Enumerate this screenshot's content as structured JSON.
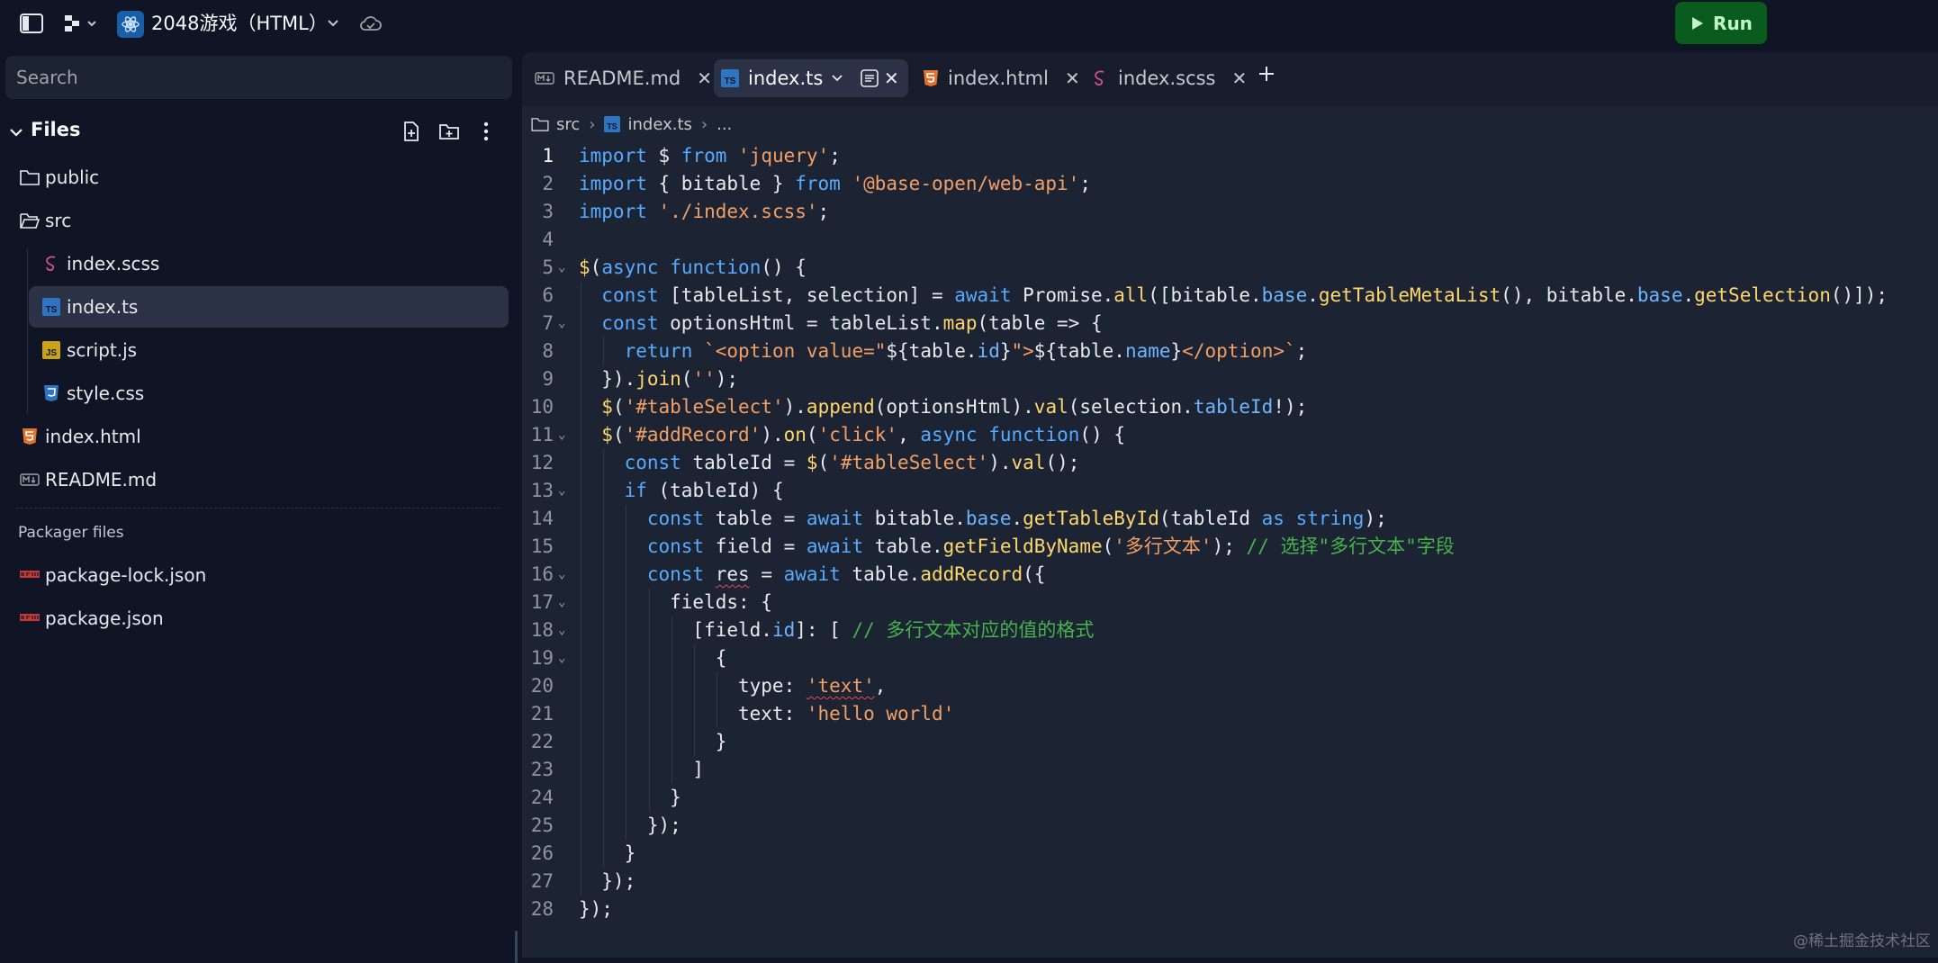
{
  "topbar": {
    "repl_name": "2048游戏（HTML）",
    "run_label": "Run"
  },
  "sidebar": {
    "search_placeholder": "Search",
    "files_title": "Files",
    "tree": [
      {
        "label": "public",
        "icon": "folder-icon"
      },
      {
        "label": "src",
        "icon": "folder-open-icon"
      },
      {
        "label": "index.scss",
        "icon": "scss-file-icon"
      },
      {
        "label": "index.ts",
        "icon": "ts-file-icon",
        "selected": true
      },
      {
        "label": "script.js",
        "icon": "js-file-icon"
      },
      {
        "label": "style.css",
        "icon": "css-file-icon"
      },
      {
        "label": "index.html",
        "icon": "html-file-icon"
      },
      {
        "label": "README.md",
        "icon": "markdown-file-icon"
      }
    ],
    "packager_title": "Packager files",
    "packager_files": [
      "package-lock.json",
      "package.json"
    ]
  },
  "editor": {
    "tabs": [
      {
        "label": "README.md",
        "icon": "markdown-file-icon"
      },
      {
        "label": "index.ts",
        "icon": "ts-file-icon",
        "active": true
      },
      {
        "label": "index.html",
        "icon": "html-file-icon"
      },
      {
        "label": "index.scss",
        "icon": "scss-file-icon"
      }
    ],
    "breadcrumb": [
      "src",
      "index.ts",
      "..."
    ],
    "line_numbers": [
      "1",
      "2",
      "3",
      "4",
      "5",
      "6",
      "7",
      "8",
      "9",
      "10",
      "11",
      "12",
      "13",
      "14",
      "15",
      "16",
      "17",
      "18",
      "19",
      "20",
      "21",
      "22",
      "23",
      "24",
      "25",
      "26",
      "27",
      "28"
    ],
    "code": [
      "import $ from 'jquery';",
      "import { bitable } from '@base-open/web-api';",
      "import './index.scss';",
      "",
      "$(async function() {",
      "  const [tableList, selection] = await Promise.all([bitable.base.getTableMetaList(), bitable.base.getSelection()]);",
      "  const optionsHtml = tableList.map(table => {",
      "    return `<option value=\"${table.id}\">${table.name}</option>`;",
      "  }).join('');",
      "  $('#tableSelect').append(optionsHtml).val(selection.tableId!);",
      "  $('#addRecord').on('click', async function() {",
      "    const tableId = $('#tableSelect').val();",
      "    if (tableId) {",
      "      const table = await bitable.base.getTableById(tableId as string);",
      "      const field = await table.getFieldByName('多行文本'); // 选择\"多行文本\"字段",
      "      const res = await table.addRecord({",
      "        fields: {",
      "          [field.id]: [ // 多行文本对应的值的格式",
      "            {",
      "              type: 'text',",
      "              text: 'hello world'",
      "            }",
      "          ]",
      "        }",
      "      });",
      "    }",
      "  });",
      "});"
    ]
  },
  "watermark": "@稀土掘金技术社区",
  "colors": {
    "background": "#0f1524",
    "editor_bg": "#1c2333",
    "keyword": "#57abff",
    "string": "#f29f64",
    "function": "#ffd86b",
    "comment": "#46b34b",
    "run_button": "#0a5c1e"
  }
}
